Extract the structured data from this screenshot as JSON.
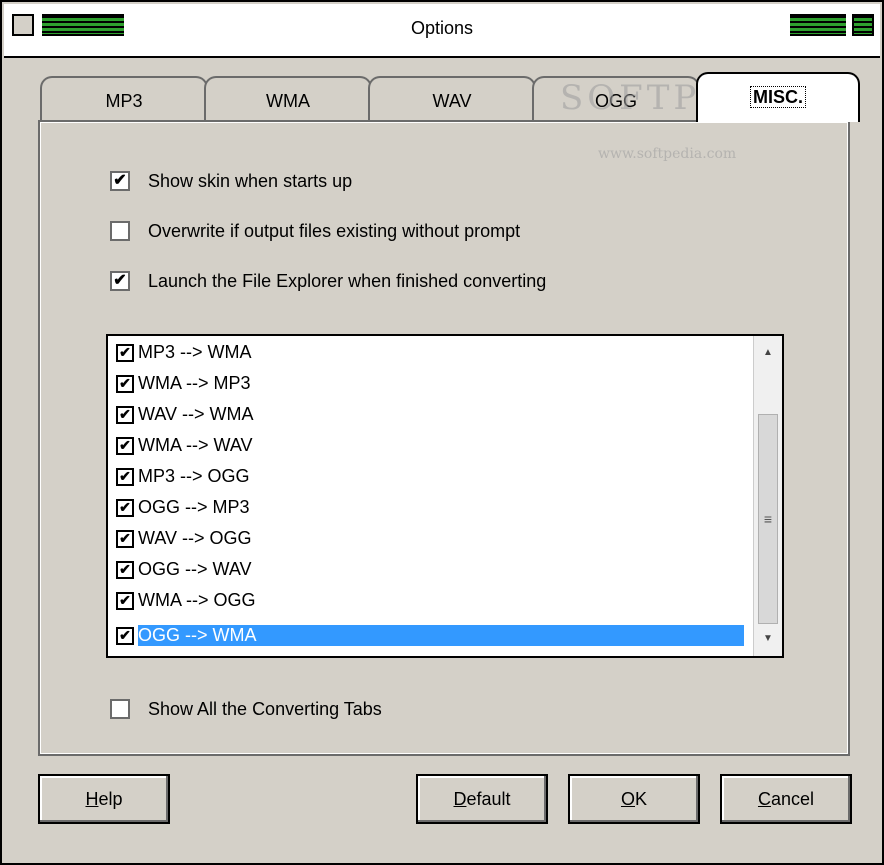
{
  "window": {
    "title": "Options"
  },
  "tabs": [
    {
      "label": "MP3",
      "active": false
    },
    {
      "label": "WMA",
      "active": false
    },
    {
      "label": "WAV",
      "active": false
    },
    {
      "label": "OGG",
      "active": false
    },
    {
      "label": "MISC.",
      "active": true
    }
  ],
  "options": [
    {
      "label": "Show skin when starts up",
      "checked": true
    },
    {
      "label": "Overwrite if output files existing without prompt",
      "checked": false
    },
    {
      "label": "Launch the File Explorer when finished converting",
      "checked": true
    }
  ],
  "conversions": [
    {
      "label": "MP3 --> WMA",
      "checked": true,
      "selected": false
    },
    {
      "label": "WMA --> MP3",
      "checked": true,
      "selected": false
    },
    {
      "label": "WAV --> WMA",
      "checked": true,
      "selected": false
    },
    {
      "label": "WMA --> WAV",
      "checked": true,
      "selected": false
    },
    {
      "label": "MP3 --> OGG",
      "checked": true,
      "selected": false
    },
    {
      "label": "OGG --> MP3",
      "checked": true,
      "selected": false
    },
    {
      "label": "WAV --> OGG",
      "checked": true,
      "selected": false
    },
    {
      "label": "OGG --> WAV",
      "checked": true,
      "selected": false
    },
    {
      "label": "WMA --> OGG",
      "checked": true,
      "selected": false
    },
    {
      "label": "OGG --> WMA",
      "checked": true,
      "selected": true
    }
  ],
  "show_all_tabs": {
    "label": "Show All the Converting Tabs",
    "checked": false
  },
  "buttons": {
    "help": {
      "mnemonic": "H",
      "rest": "elp"
    },
    "default": {
      "mnemonic": "D",
      "rest": "efault"
    },
    "ok": {
      "mnemonic": "O",
      "rest": "K"
    },
    "cancel": {
      "mnemonic": "C",
      "rest": "ancel"
    }
  },
  "watermark": {
    "brand": "SOFTPEDIA",
    "url": "www.softpedia.com"
  },
  "colors": {
    "selection": "#3399ff",
    "titlebar_grip": "#2ea02e",
    "face": "#d4d0c8"
  }
}
